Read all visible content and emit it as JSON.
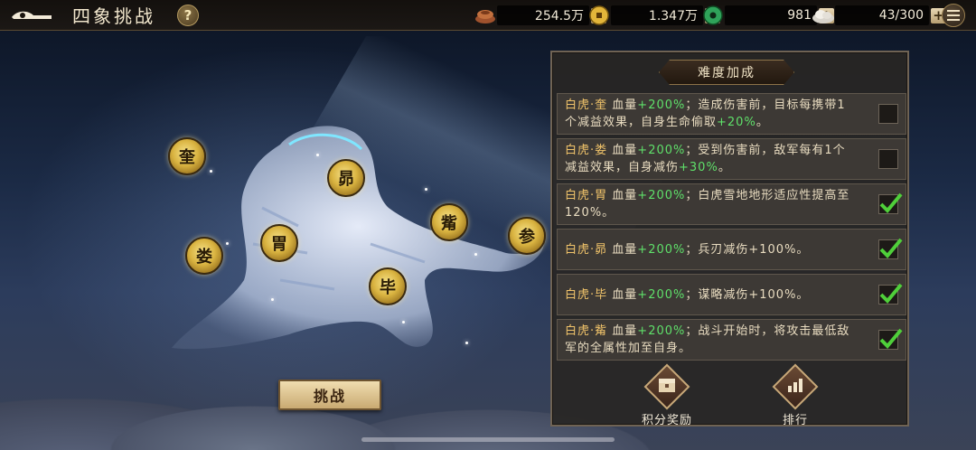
{
  "header": {
    "title": "四象挑战",
    "help_label": "?"
  },
  "resources": [
    {
      "icon": "copper-coins-icon",
      "value": "254.5万"
    },
    {
      "icon": "gold-coin-icon",
      "value": "1.347万"
    },
    {
      "icon": "jade-icon",
      "value": "981"
    },
    {
      "icon": "stamina-icon",
      "value": "43/300"
    }
  ],
  "plus_label": "+",
  "constellation": {
    "nodes": [
      "奎",
      "昴",
      "觜",
      "参",
      "娄",
      "胃",
      "毕"
    ]
  },
  "challenge_button": "挑战",
  "panel": {
    "title": "难度加成",
    "items": [
      {
        "name": "白虎·奎",
        "hp": "血量",
        "hp_val": "+200%",
        "sep": "；",
        "effect_a": "造成伤害前，目标每携带1个减益效果，自身生命偷取",
        "effect_val": "+20%",
        "effect_b": "。",
        "checked": false
      },
      {
        "name": "白虎·娄",
        "hp": "血量",
        "hp_val": "+200%",
        "sep": "；",
        "effect_a": "受到伤害前，敌军每有1个减益效果，自身减伤",
        "effect_val": "+30%",
        "effect_b": "。",
        "checked": false
      },
      {
        "name": "白虎·胃",
        "hp": "血量",
        "hp_val": "+200%",
        "sep": "；",
        "effect_a": "白虎雪地地形适应性提高至120%。",
        "effect_val": "",
        "effect_b": "",
        "checked": true
      },
      {
        "name": "白虎·昴",
        "hp": "血量",
        "hp_val": "+200%",
        "sep": "；",
        "effect_a": "兵刃减伤+100%。",
        "effect_val": "",
        "effect_b": "",
        "checked": true
      },
      {
        "name": "白虎·毕",
        "hp": "血量",
        "hp_val": "+200%",
        "sep": "；",
        "effect_a": "谋略减伤+100%。",
        "effect_val": "",
        "effect_b": "",
        "checked": true
      },
      {
        "name": "白虎·觜",
        "hp": "血量",
        "hp_val": "+200%",
        "sep": "；",
        "effect_a": "战斗开始时，将攻击最低敌军的全属性加至自身。",
        "effect_val": "",
        "effect_b": "",
        "checked": true
      }
    ],
    "reward_button": "积分奖励",
    "rank_button": "排行"
  },
  "colors": {
    "accent_gold": "#f0c36a",
    "highlight_green": "#5fe06a",
    "check_green": "#4fcf3a"
  }
}
